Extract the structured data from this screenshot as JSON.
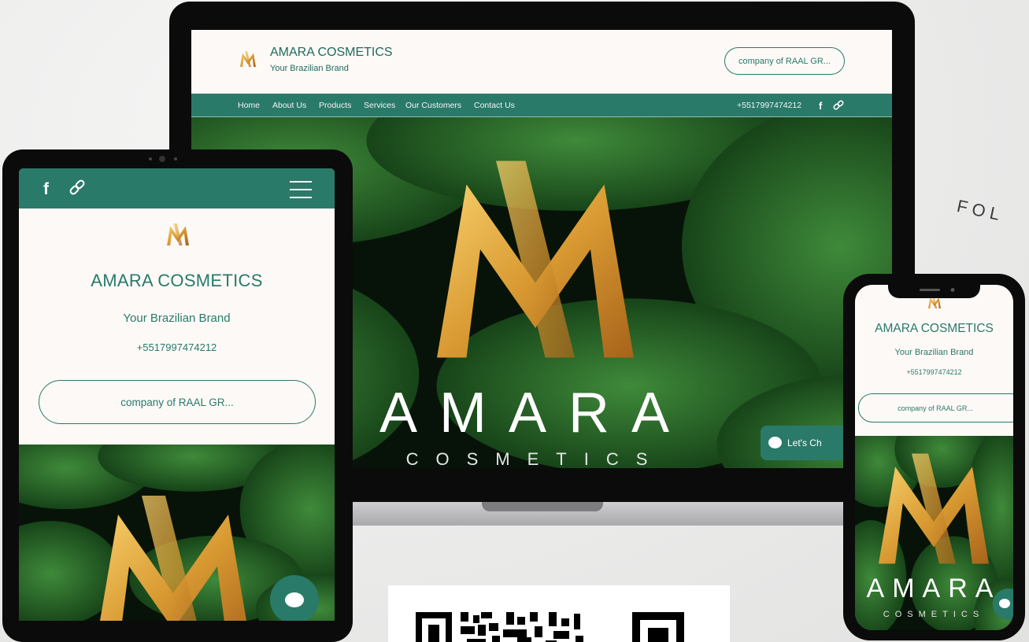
{
  "brand": {
    "name": "AMARA COSMETICS",
    "tagline": "Your Brazilian Brand",
    "phone": "+5517997474212",
    "company_button": "company of RAAL GR...",
    "hero_word": "AMARA",
    "hero_subword": "COSMETICS"
  },
  "laptop": {
    "nav": [
      "Home",
      "About Us",
      "Products",
      "Services",
      "Our Customers",
      "Contact Us"
    ],
    "chat_label": "Let's Ch"
  },
  "backdrop": {
    "curved_text": "FOL"
  },
  "colors": {
    "brand_teal": "#2a7a6a",
    "header_bg": "#fcf9f7",
    "gold": "#d99a32"
  },
  "icons": [
    "facebook-icon",
    "link-icon",
    "hamburger-menu-icon",
    "chat-bubble-icon",
    "amara-logo-icon",
    "qr-code-icon"
  ]
}
